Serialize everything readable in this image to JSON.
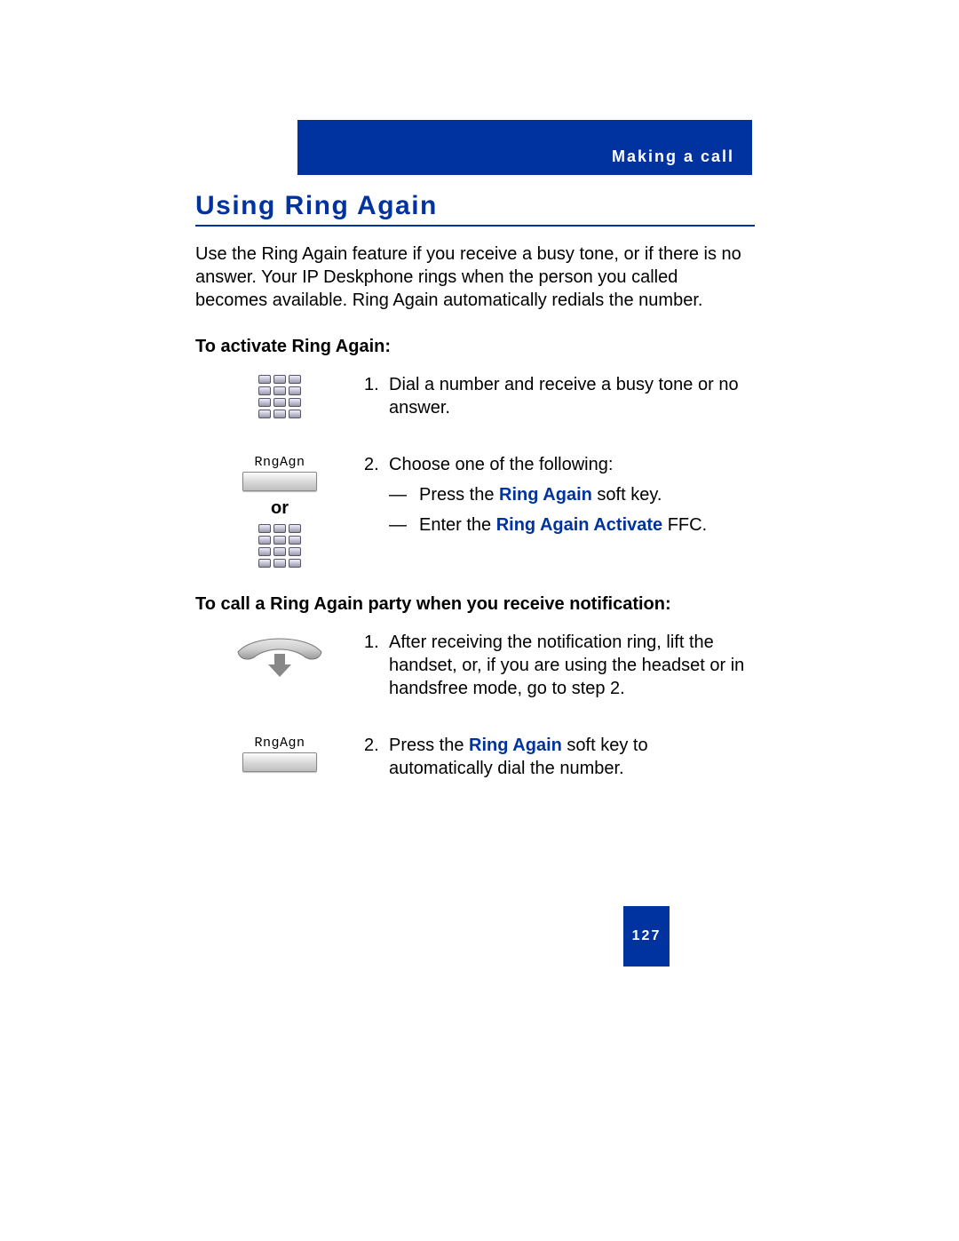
{
  "header": {
    "section": "Making a call"
  },
  "title": "Using Ring Again",
  "intro": "Use the Ring Again feature if you receive a busy tone, or if there is no answer. Your IP Deskphone rings when the person you called becomes available. Ring Again automatically redials the number.",
  "sectionA": {
    "heading": "To activate Ring Again:",
    "step1_num": "1.",
    "step1_text": "Dial a number and receive a busy tone or no answer.",
    "step2_num": "2.",
    "step2_text": "Choose one of the following:",
    "softkey_label": "RngAgn",
    "or_label": "or",
    "opt1_pre": "Press the ",
    "opt1_bold": "Ring Again",
    "opt1_post": " soft key.",
    "opt2_pre": "Enter the ",
    "opt2_bold": "Ring Again Activate",
    "opt2_post": " FFC."
  },
  "sectionB": {
    "heading": "To call a Ring Again party when you receive notification:",
    "step1_num": "1.",
    "step1_text": "After receiving the notification ring, lift the handset, or, if you are using the headset or in handsfree mode, go to step 2.",
    "step2_num": "2.",
    "step2_pre": "Press the ",
    "step2_bold": "Ring Again",
    "step2_post": " soft key to automatically dial the number.",
    "softkey_label": "RngAgn"
  },
  "page_number": "127"
}
